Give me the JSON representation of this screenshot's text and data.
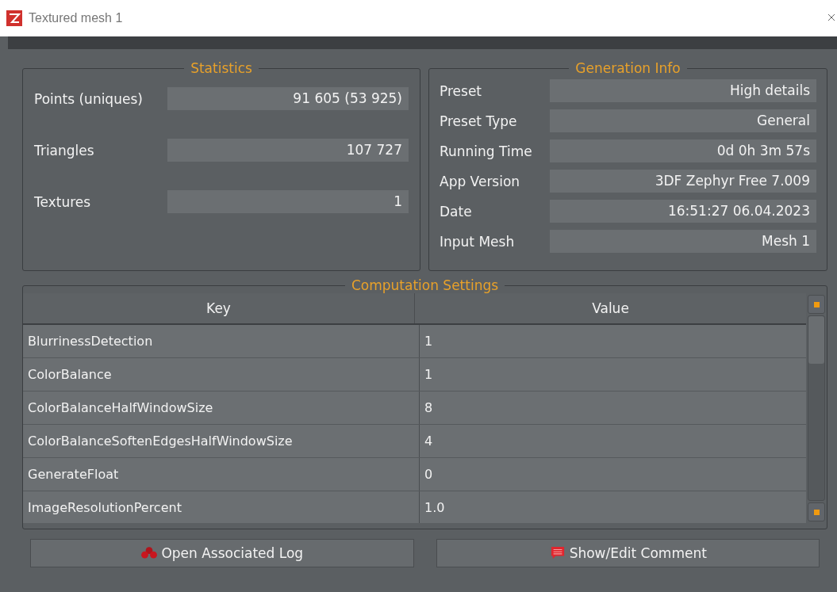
{
  "window": {
    "title": "Textured mesh 1"
  },
  "statistics": {
    "title": "Statistics",
    "rows": [
      {
        "label": "Points (uniques)",
        "value": "91 605 (53 925)"
      },
      {
        "label": "Triangles",
        "value": "107 727"
      },
      {
        "label": "Textures",
        "value": "1"
      }
    ]
  },
  "generation_info": {
    "title": "Generation Info",
    "rows": [
      {
        "label": "Preset",
        "value": "High details"
      },
      {
        "label": "Preset Type",
        "value": "General"
      },
      {
        "label": "Running Time",
        "value": "0d 0h 3m 57s"
      },
      {
        "label": "App Version",
        "value": "3DF Zephyr Free 7.009"
      },
      {
        "label": "Date",
        "value": "16:51:27 06.04.2023"
      },
      {
        "label": "Input Mesh",
        "value": "Mesh 1"
      }
    ]
  },
  "computation_settings": {
    "title": "Computation Settings",
    "table": {
      "columns": [
        "Key",
        "Value"
      ],
      "rows": [
        [
          "BlurrinessDetection",
          "1"
        ],
        [
          "ColorBalance",
          "1"
        ],
        [
          "ColorBalanceHalfWindowSize",
          "8"
        ],
        [
          "ColorBalanceSoftenEdgesHalfWindowSize",
          "4"
        ],
        [
          "GenerateFloat",
          "0"
        ],
        [
          "ImageResolutionPercent",
          "1.0"
        ]
      ]
    }
  },
  "buttons": [
    {
      "label": "Open Associated Log",
      "kind": "log"
    },
    {
      "label": "Show/Edit Comment",
      "kind": "comment"
    }
  ]
}
